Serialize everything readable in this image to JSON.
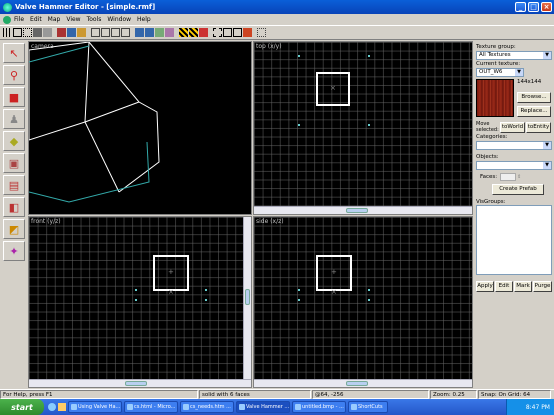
{
  "window": {
    "title": "Valve Hammer Editor - [simple.rmf]"
  },
  "menu": [
    "File",
    "Edit",
    "Map",
    "View",
    "Tools",
    "Window",
    "Help"
  ],
  "viewports": {
    "camera": "camera",
    "top": "top (x/y)",
    "front": "front (y/z)",
    "side": "side (x/z)"
  },
  "right_panel": {
    "texture_group_label": "Texture group:",
    "texture_group_value": "All Textures",
    "current_texture_label": "Current texture:",
    "current_texture_value": "OUT_W6",
    "texture_size": "144x144",
    "browse_label": "Browse...",
    "replace_label": "Replace...",
    "move_selected_label": "Move selected:",
    "to_world_label": "toWorld",
    "to_entity_label": "toEntity",
    "categories_label": "Categories:",
    "objects_label": "Objects:",
    "faces_label": "Faces:",
    "create_prefab_label": "Create Prefab",
    "visgroups_label": "VisGroups:",
    "apply_label": "Apply",
    "edit_label": "Edit",
    "mark_label": "Mark",
    "purge_label": "Purge"
  },
  "status": {
    "help": "For Help, press F1",
    "selection": "solid with 6 faces",
    "coords": "@64, -256",
    "zoom": "Zoom: 0.25",
    "snap": "Snap: On Grid: 64"
  },
  "taskbar": {
    "start": "start",
    "tasks": [
      "Using Valve Ha...",
      "cs.html - Micro...",
      "cs_needs.htm ...",
      "Valve Hammer ...",
      "untitled.bmp - ...",
      "ShortCuts"
    ],
    "clock": "8:47 PM"
  },
  "colors": {
    "titlebar": "#0a5fd8",
    "taskbar": "#2456c8",
    "grid_line": "#646464",
    "brush_outline": "#ffffff"
  }
}
